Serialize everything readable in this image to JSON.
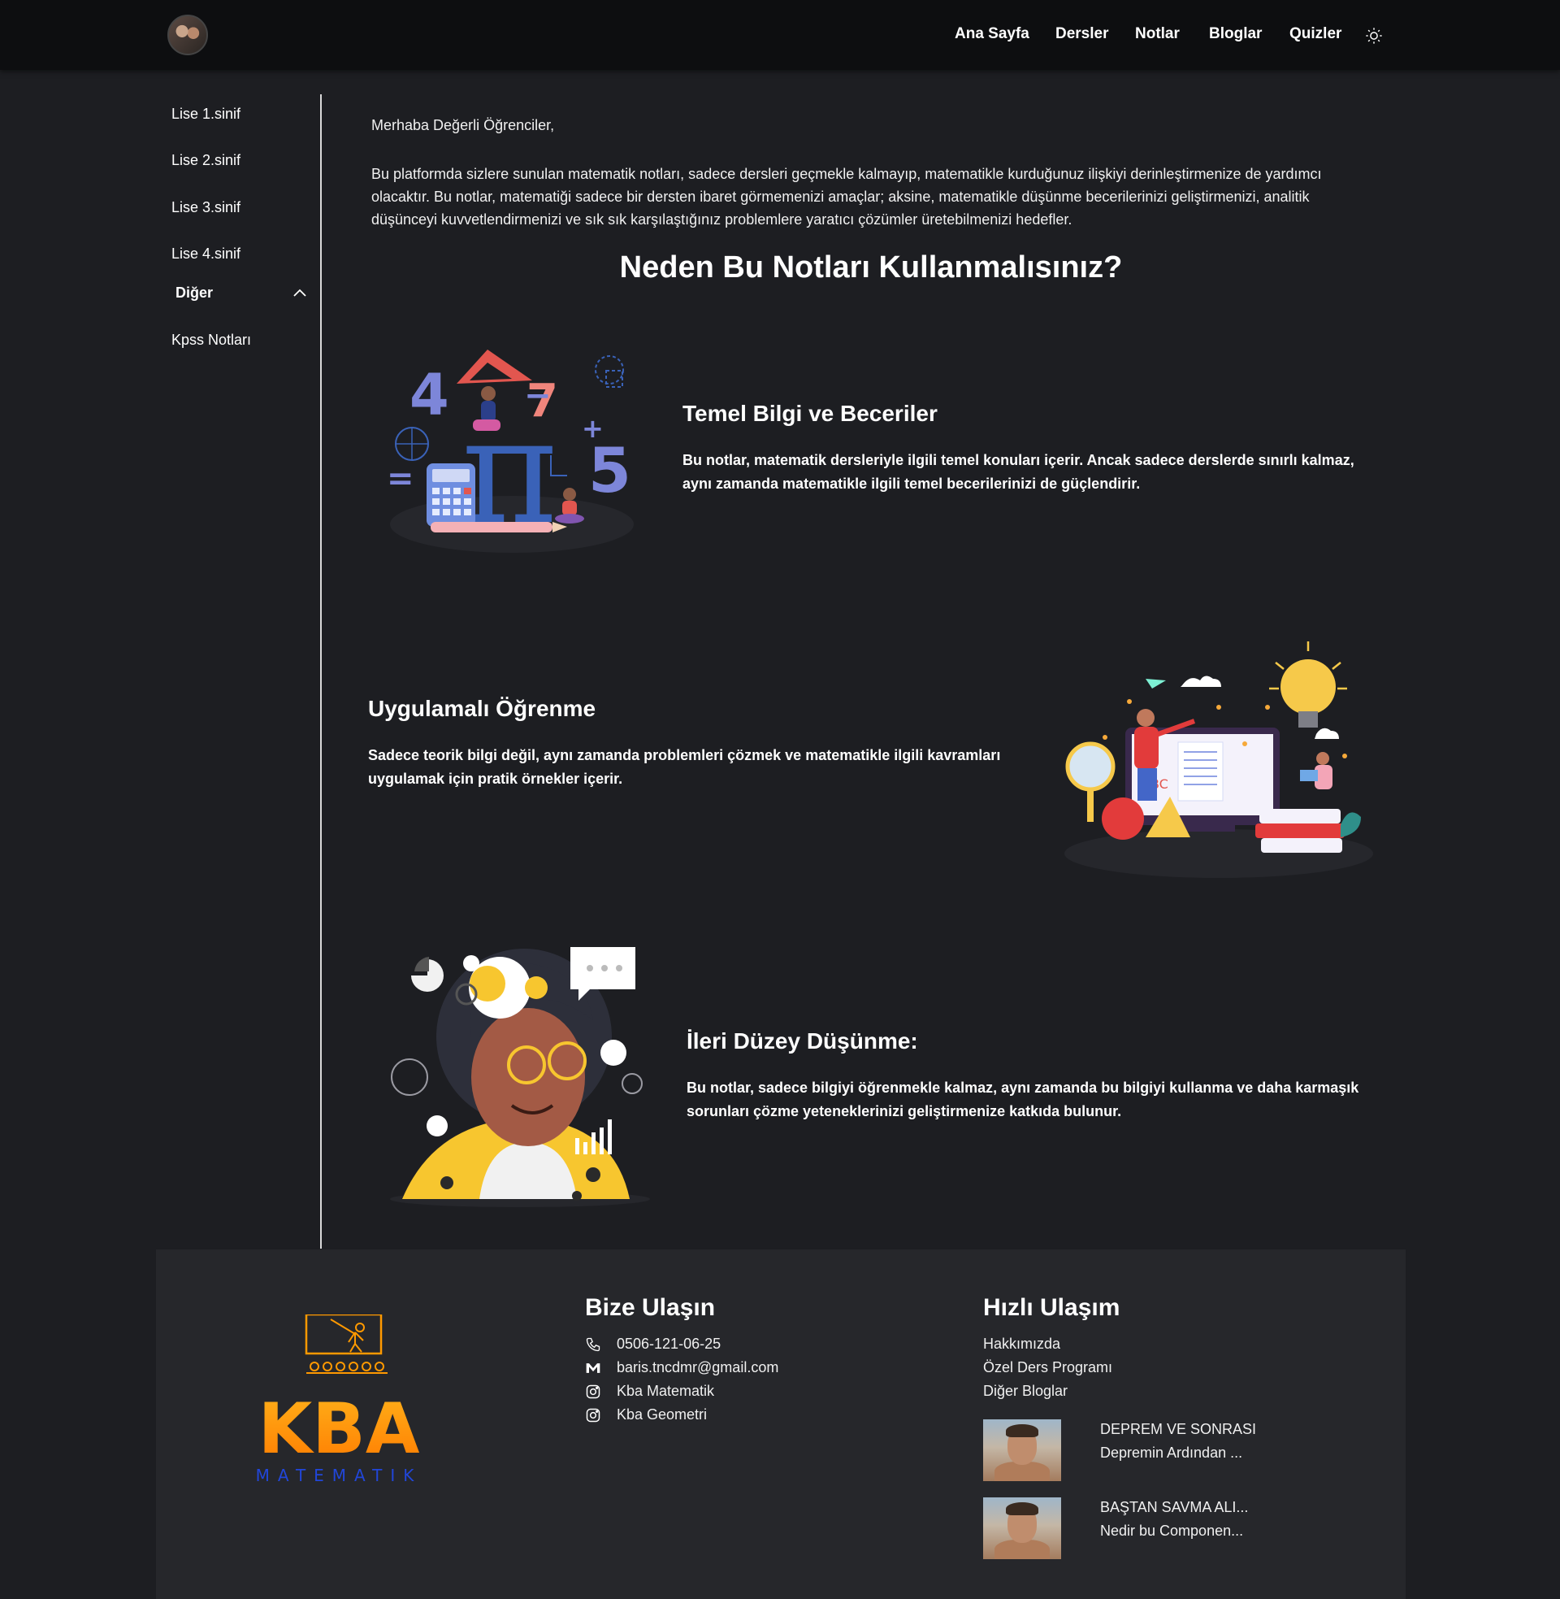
{
  "header": {
    "nav": [
      {
        "label": "Ana Sayfa"
      },
      {
        "label": "Dersler"
      },
      {
        "label": "Notlar"
      },
      {
        "label": "Bloglar"
      },
      {
        "label": "Quizler"
      }
    ],
    "theme_icon": "sun-icon"
  },
  "sidebar": {
    "items": [
      {
        "label": "Lise 1.sinif"
      },
      {
        "label": "Lise 2.sinif"
      },
      {
        "label": "Lise 3.sinif"
      },
      {
        "label": "Lise 4.sinif"
      }
    ],
    "group": {
      "label": "Diğer",
      "icon": "chevron-up-icon",
      "children": [
        {
          "label": "Kpss Notları"
        }
      ]
    }
  },
  "main": {
    "greeting": "Merhaba Değerli Öğrenciler,",
    "intro": "Bu platformda sizlere sunulan matematik notları, sadece dersleri geçmekle kalmayıp, matematikle kurduğunuz ilişkiyi derinleştirmenize de yardımcı olacaktır. Bu notlar, matematiği sadece bir dersten ibaret görmemenizi amaçlar; aksine, matematikle düşünme becerilerinizi geliştirmenizi, analitik düşünceyi kuvvetlendirmenizi ve sık sık karşılaştığınız problemlere yaratıcı çözümler üretebilmenizi hedefler.",
    "section_title": "Neden Bu Notları Kullanmalısınız?",
    "features": [
      {
        "title": "Temel Bilgi ve Beceriler",
        "text": "Bu notlar, matematik dersleriyle ilgili temel konuları içerir. Ancak sadece derslerde sınırlı kalmaz, aynı zamanda matematikle ilgili temel becerilerinizi de güçlendirir."
      },
      {
        "title": "Uygulamalı Öğrenme",
        "text": "Sadece teorik bilgi değil, aynı zamanda problemleri çözmek ve matematikle ilgili kavramları uygulamak için pratik örnekler içerir."
      },
      {
        "title": "İleri Düzey Düşünme:",
        "text": "Bu notlar, sadece bilgiyi öğrenmekle kalmaz, aynı zamanda bu bilgiyi kullanma ve daha karmaşık sorunları çözme yeteneklerinizi geliştirmenize katkıda bulunur."
      }
    ],
    "illustration_texts": {
      "four": "4",
      "seven": "7",
      "minus": "−",
      "plus": "+",
      "five": "5",
      "equals": "=",
      "pi": "π",
      "abc": "ABC"
    }
  },
  "footer": {
    "logo": {
      "main": "KBA",
      "sub": "MATEMATIK"
    },
    "contact": {
      "title": "Bize Ulaşın",
      "items": [
        {
          "icon": "phone-icon",
          "text": "0506-121-06-25"
        },
        {
          "icon": "mail-icon",
          "text": "baris.tncdmr@gmail.com"
        },
        {
          "icon": "instagram-icon",
          "text": "Kba Matematik"
        },
        {
          "icon": "instagram-icon",
          "text": "Kba Geometri"
        }
      ]
    },
    "quick": {
      "title": "Hızlı Ulaşım",
      "links": [
        {
          "label": "Hakkımızda"
        },
        {
          "label": "Özel Ders Programı"
        },
        {
          "label": "Diğer Bloglar"
        }
      ],
      "blogs": [
        {
          "title": "DEPREM VE SONRASI",
          "excerpt": "Depremin Ardından ..."
        },
        {
          "title": "BAŞTAN SAVMA ALI...",
          "excerpt": "Nedir bu Componen..."
        }
      ]
    }
  },
  "colors": {
    "background": "#1d1e22",
    "header": "#0d0e10",
    "footer": "#26272b",
    "logo_orange": "#ff9900",
    "logo_blue": "#2146d9"
  }
}
